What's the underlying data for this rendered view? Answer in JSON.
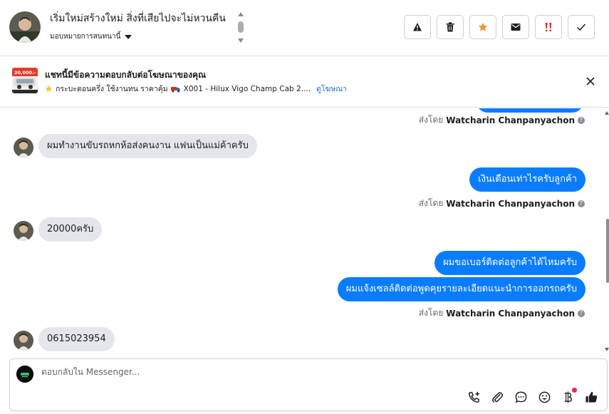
{
  "header": {
    "title": "เริ่มใหม่สร้างใหม่ สิ่งที่เสียไปจะไม่หวนคืน",
    "assign_label": "มอบหมายการสนทนานี้",
    "actions": [
      {
        "name": "report-spam-button",
        "icon": "warning-icon"
      },
      {
        "name": "delete-button",
        "icon": "trash-icon"
      },
      {
        "name": "star-button",
        "icon": "star-icon"
      },
      {
        "name": "mark-unread-button",
        "icon": "envelope-icon"
      },
      {
        "name": "follow-up-button",
        "icon": "double-exclamation-icon"
      },
      {
        "name": "mark-done-button",
        "icon": "checkmark-icon"
      }
    ],
    "colors": {
      "star": "#f7923b",
      "followup": "#e02020"
    }
  },
  "ad_banner": {
    "title": "แชทนี้มีข้อความตอบกลับต่อโฆษณาของคุณ",
    "subtitle": "กระบะตอนครึ่ง ใช้งานทน ราคาคุ้ม",
    "ad_name": "X001 - Hilux Vigo Champ Cab 2....",
    "link": "ดูโฆษณา",
    "thumb_text": "20,000.-"
  },
  "messages": {
    "sent_by_prefix": "ส่งโดย",
    "agent_name": "Watcharin Chanpanyachon",
    "items": [
      {
        "dir": "in",
        "text": "ผมทำงานขับรถหกห้อส่งคนงาน แฟนเป็นแม่ค้าครับ"
      },
      {
        "dir": "out",
        "text": "เงินเดือนเท่าไรครับลูกค้า"
      },
      {
        "dir": "in",
        "text": "20000ครับ"
      },
      {
        "dir": "out",
        "text": "ผมขอเบอร์ติดต่อลูกค้าได้ไหมครับ"
      },
      {
        "dir": "out",
        "text": "ผมแจ้งเซลล์ติดต่อพูดคุยรายละเอียดแนะนำการออกรถครับ"
      },
      {
        "dir": "in",
        "text": "0615023954"
      }
    ]
  },
  "composer": {
    "placeholder": "ตอบกลับใน Messenger...",
    "tools": [
      "call-add-icon",
      "paperclip-icon",
      "chat-bubble-icon",
      "emoji-icon",
      "baht-icon",
      "thumbs-up-icon"
    ]
  },
  "accent_color": "#0a7cff"
}
